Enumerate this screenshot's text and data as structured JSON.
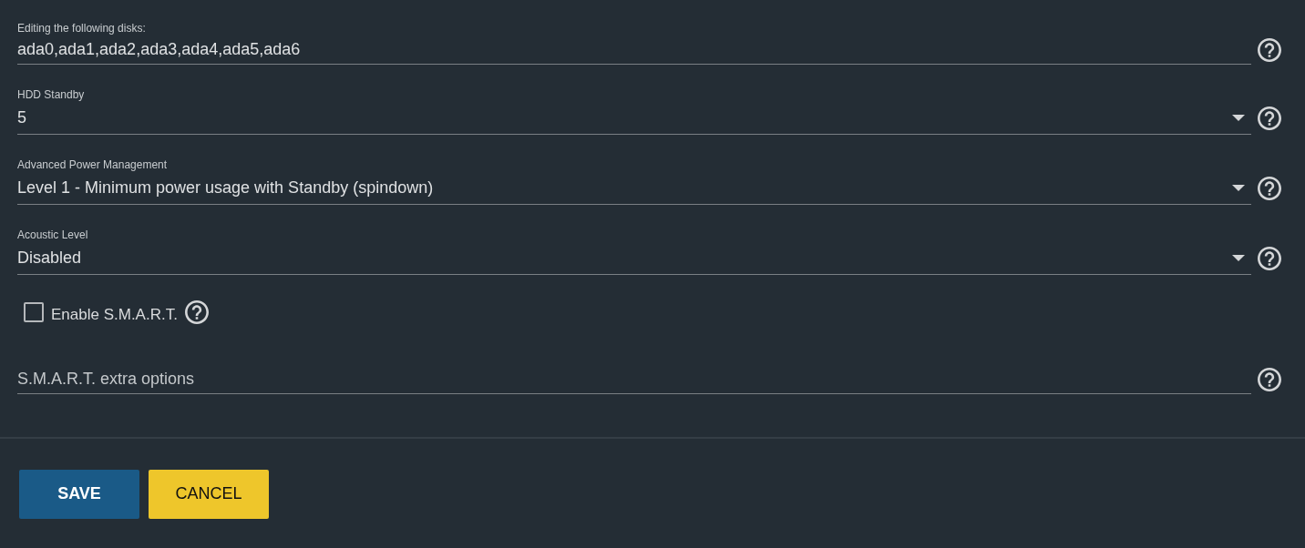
{
  "fields": [
    {
      "kind": "text",
      "label": "Editing the following disks:",
      "value": "ada0,ada1,ada2,ada3,ada4,ada5,ada6"
    },
    {
      "kind": "select",
      "label": "HDD Standby",
      "value": "5"
    },
    {
      "kind": "select",
      "label": "Advanced Power Management",
      "value": "Level 1 - Minimum power usage with Standby (spindown)"
    },
    {
      "kind": "select",
      "label": "Acoustic Level",
      "value": "Disabled"
    },
    {
      "kind": "checkbox",
      "label": "Enable S.M.A.R.T.",
      "checked": false
    },
    {
      "kind": "text",
      "placeholder": "S.M.A.R.T. extra options"
    }
  ],
  "buttons": [
    {
      "kind": "primary",
      "label": "SAVE"
    },
    {
      "kind": "secondary",
      "label": "CANCEL"
    }
  ]
}
